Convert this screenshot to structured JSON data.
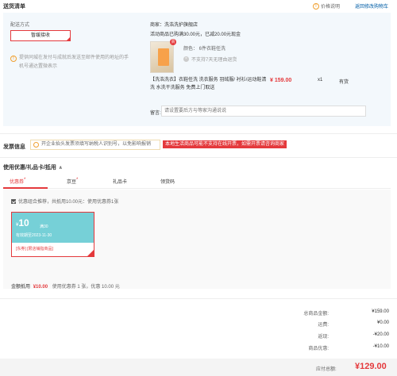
{
  "header": {
    "title": "送货清单",
    "price_note": "价格说明",
    "back_to_cart": "返回修改购物车"
  },
  "delivery": {
    "label": "配送方式",
    "method": "暂缓接收",
    "note": "提供同城在发付与成就后发送至邮件使用的地址的手机号通达置微表示"
  },
  "shop": {
    "name": "商家：洗浩洗护旗舰店",
    "promo": "活动商品已购满30.00元，已减20.00元现金",
    "product": {
      "color": "颜色：   6件衣鞋任洗",
      "no_return": "不支持7天无理由退货",
      "title": "【洗浩洗衣】衣鞋任洗 洗衣服务 羽绒服/ 衬衫/运动鞋清洗 水洗干洗服务 免费上门取送",
      "price": "¥ 159.00",
      "qty": "x1",
      "stock": "有货",
      "badge": "贵"
    },
    "remark_label": "留言:",
    "remark_placeholder": "请设置要后方与等家沟通说说"
  },
  "invoice": {
    "title": "发票信息",
    "tip": "开企业抬头发票须填写纳税人识别号，以免影响报销",
    "warning": "本地生活商品可能不支持在线开票，如需开票请咨询商家"
  },
  "coupons": {
    "title": "使用优惠/礼品卡/抵用",
    "chevron": "∧",
    "tabs": [
      {
        "label": "优惠券",
        "star": "*"
      },
      {
        "label": "京豆",
        "star": "*"
      },
      {
        "label": "礼品卡",
        "star": ""
      },
      {
        "label": "领货码",
        "star": ""
      }
    ],
    "check_label": "优惠组合推荐，共抵用10.00元：使用优惠券1张",
    "card": {
      "symbol": "¥",
      "amount": "10",
      "condition": "满30",
      "expiry": "有效期至2023-11-30",
      "scope": "[东券] [限店铺指商品]"
    },
    "summary_label": "金额抵用",
    "summary_amount": "¥10.00",
    "summary_used": "使用优惠券 1 张，优惠 10.00 元"
  },
  "totals": {
    "rows": [
      {
        "label": "总商品金额:",
        "value": "¥159.00"
      },
      {
        "label": "运费:",
        "value": "¥0.00"
      },
      {
        "label": "返现:",
        "value": "-¥20.00"
      },
      {
        "label": "商品优惠:",
        "value": "-¥10.00"
      }
    ],
    "pay_label": "应付总额:",
    "pay_amount": "¥129.00"
  },
  "colors": {
    "accent": "#e4393c",
    "link": "#005ea7",
    "panel": "#f3f8fc",
    "coupon": "#76d0d7"
  }
}
